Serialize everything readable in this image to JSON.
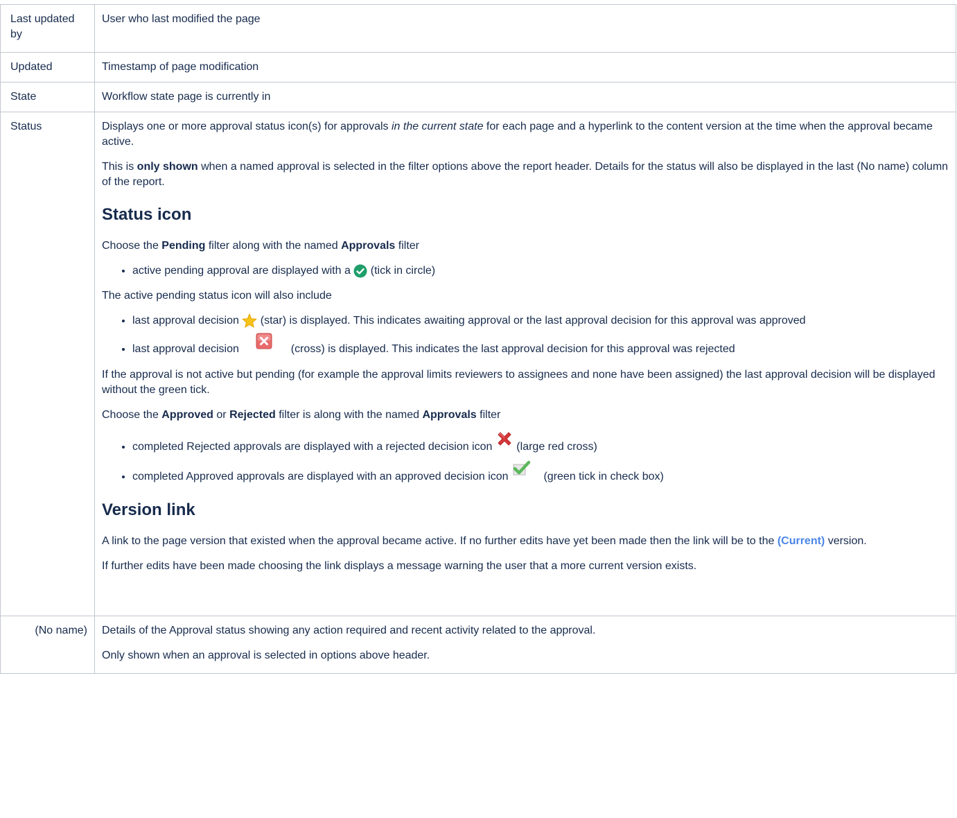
{
  "rows": [
    {
      "key": "Last updated by",
      "value": "User who last modified the page"
    },
    {
      "key": "Updated",
      "value": "Timestamp of page modification"
    },
    {
      "key": "State",
      "value": "Workflow state page is currently in"
    },
    {
      "key": "Status",
      "intro": {
        "p1_a": "Displays one or more approval status icon(s) for approvals ",
        "p1_em": "in the current state",
        "p1_b": " for each page and a hyperlink to the content version at the time when the approval became active.",
        "p2_a": "This is ",
        "p2_bold": "only shown",
        "p2_b": " when a named approval is selected in the filter options above the report header. Details for the status will also be displayed in the last (No name) column of the report."
      },
      "status_icon": {
        "heading": "Status icon",
        "choose_a": "Choose the ",
        "choose_pending": "Pending",
        "choose_b": " filter along with the named ",
        "choose_approvals": "Approvals",
        "choose_c": " filter",
        "bullet_active_a": "active pending approval are displayed with a ",
        "bullet_active_b": " (tick in circle)",
        "include_text": "The active pending status icon will also include",
        "bullet_star_a": "last approval decision ",
        "bullet_star_b": " (star) is displayed. This indicates awaiting approval or the last approval decision for this approval was approved",
        "bullet_cross_a": "last approval decision ",
        "bullet_cross_b": " (cross) is displayed. This indicates the last approval decision for this approval was rejected",
        "not_active_text": "If the approval is not active but pending (for example the approval limits reviewers to assignees and none have been assigned) the last approval decision will be displayed without the green tick.",
        "choose2_a": "Choose the ",
        "choose2_approved": "Approved",
        "choose2_or": " or ",
        "choose2_rejected": "Rejected",
        "choose2_b": " filter is along with the named ",
        "choose2_approvals": "Approvals",
        "choose2_c": " filter",
        "bullet_rejected_a": "completed Rejected approvals are displayed with a rejected decision icon ",
        "bullet_rejected_b": " (large red cross)",
        "bullet_approved_a": "completed Approved approvals are displayed with an approved decision icon ",
        "bullet_approved_b": " (green tick in check box)"
      },
      "version_link": {
        "heading": "Version link",
        "p1_a": "A link to the page version that existed when the approval became active. If no further edits have yet been made then the link will be to the ",
        "p1_link": "(Current)",
        "p1_b": " version.",
        "p2": "If further edits have been made choosing the link displays a message warning the user that a more current version exists."
      }
    },
    {
      "key": "(No name)",
      "p1": "Details of the Approval status showing any action required and recent activity related to the approval.",
      "p2": "Only shown when an approval is selected in options above header."
    }
  ],
  "icons": {
    "tick_circle": "tick-circle-icon",
    "star": "star-icon",
    "cross_box": "cross-box-icon",
    "large_red_cross": "large-red-cross-icon",
    "green_tick_box": "green-tick-box-icon"
  },
  "colors": {
    "border": "#c1c7d0",
    "text": "#172b4d",
    "link": "#4a86e8",
    "tick_green": "#1f9e6a",
    "star_yellow": "#f7c31a",
    "cross_red": "#d9393b",
    "check_green": "#5cb85c"
  }
}
